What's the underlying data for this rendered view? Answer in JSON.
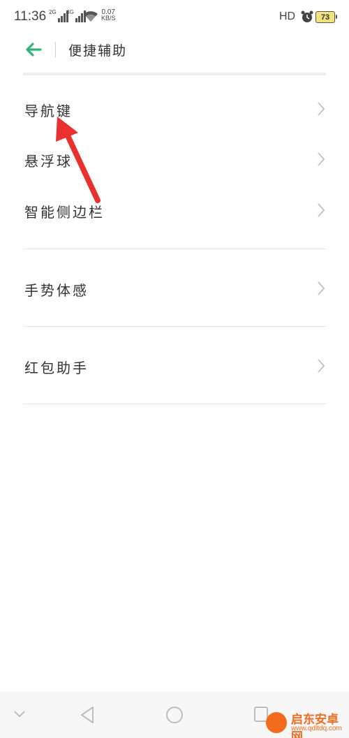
{
  "status_bar": {
    "time": "11:36",
    "net1": "2G",
    "net2": "4G",
    "speed_value": "0.07",
    "speed_unit": "KB/S",
    "hd": "HD",
    "battery": "73",
    "battery_color": "#f3e37c"
  },
  "header": {
    "title": "便捷辅助",
    "back_icon": "arrow-left-icon",
    "accent_color": "#2bb673"
  },
  "items": [
    {
      "label": "导航键"
    },
    {
      "label": "悬浮球"
    },
    {
      "label": "智能侧边栏"
    },
    {
      "label": "手势体感"
    },
    {
      "label": "红包助手"
    }
  ],
  "annotation": {
    "arrow_color": "#e8312f"
  },
  "watermark": {
    "name": "启东安卓网",
    "url": "www.qdltdq.com"
  }
}
